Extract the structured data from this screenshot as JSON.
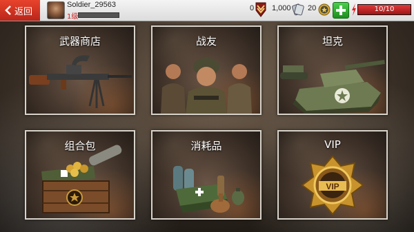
{
  "topbar": {
    "back_label": "返回",
    "player": {
      "name": "Soldier_29563",
      "level": "1级",
      "xp_progress": 0
    },
    "resources": {
      "medals": "0",
      "silver": "1,000",
      "gold": "20"
    },
    "energy": {
      "text": "10/10",
      "fraction": 1.0
    }
  },
  "cards": [
    {
      "label": "武器商店",
      "icon": "machine-gun"
    },
    {
      "label": "战友",
      "icon": "soldiers"
    },
    {
      "label": "坦克",
      "icon": "tank"
    },
    {
      "label": "组合包",
      "icon": "supply-crate"
    },
    {
      "label": "消耗品",
      "icon": "consumables"
    },
    {
      "label": "VIP",
      "icon": "vip-badge"
    }
  ],
  "colors": {
    "back_button": "#d9341f",
    "plus_button": "#2bb02b",
    "energy": "#d22a2a",
    "level_text": "#cc2222"
  }
}
